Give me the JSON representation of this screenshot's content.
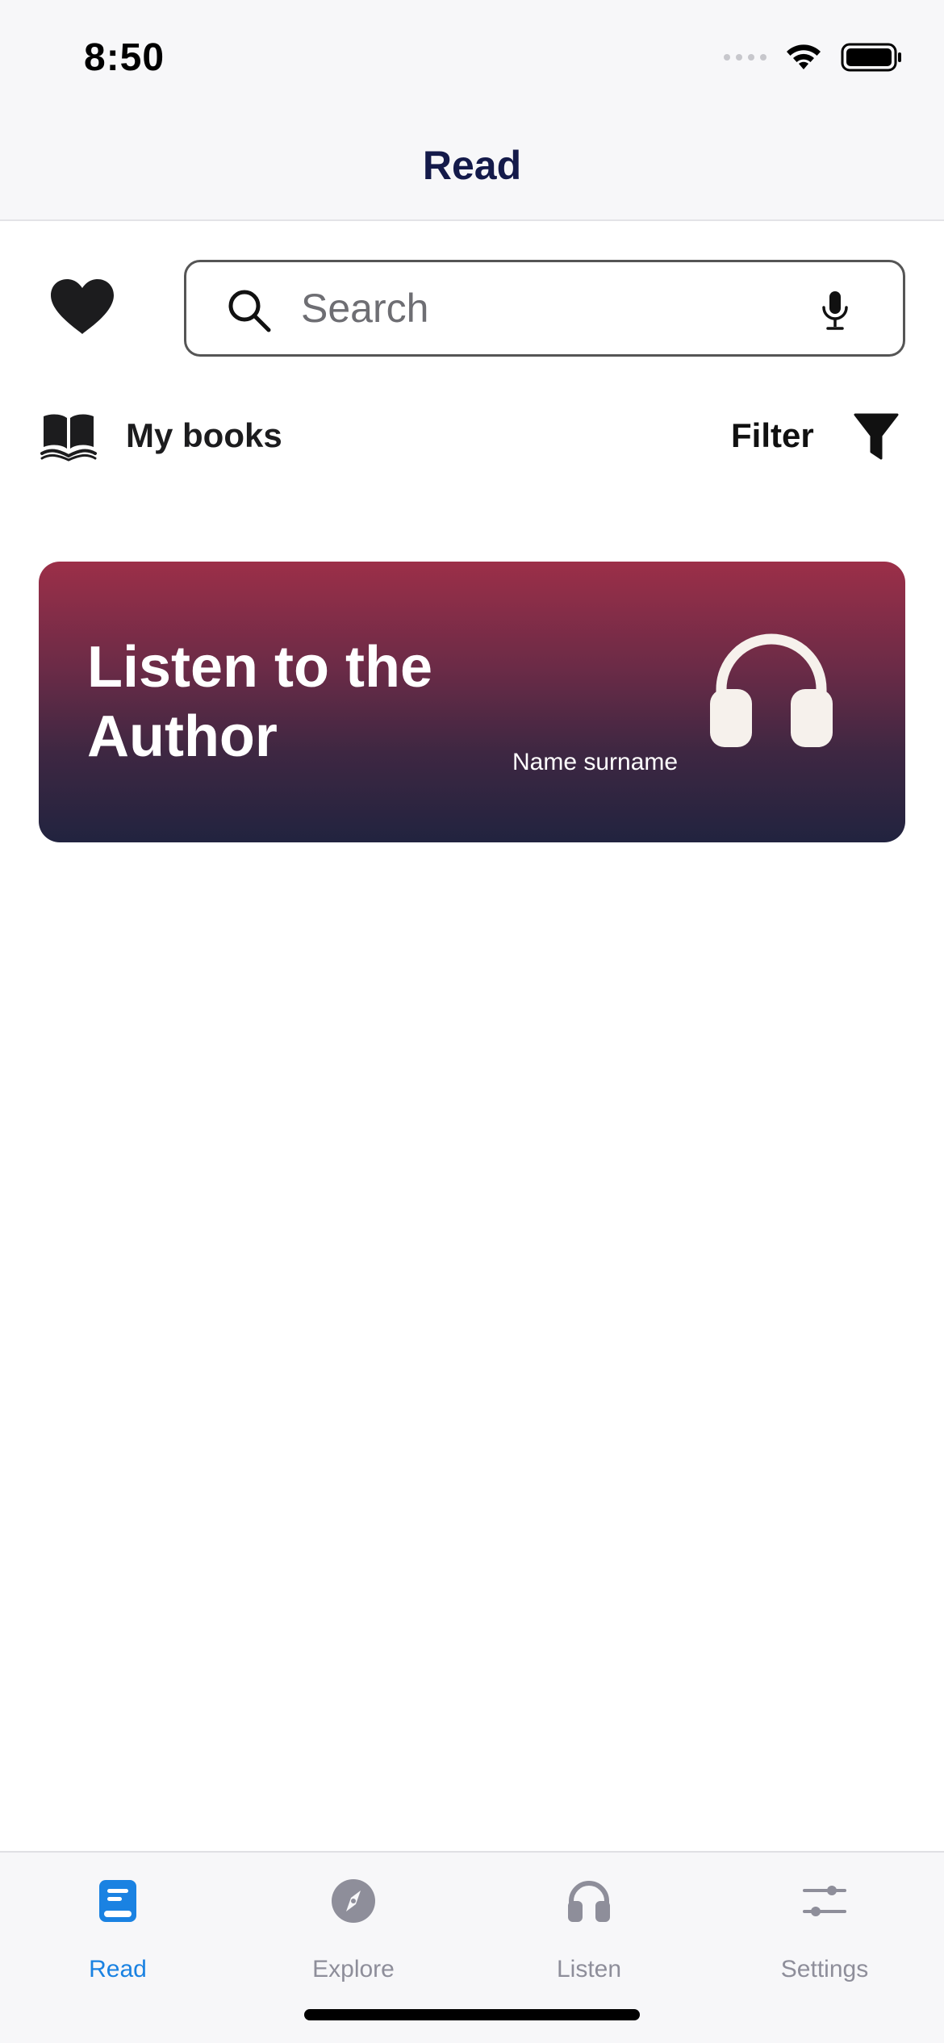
{
  "status_bar": {
    "time": "8:50",
    "icons": [
      "signal-dots-icon",
      "wifi-icon",
      "battery-icon"
    ]
  },
  "header": {
    "title": "Read"
  },
  "search": {
    "placeholder": "Search",
    "value": "",
    "left_icon": "heart-icon",
    "search_icon": "search-icon",
    "mic_icon": "microphone-icon"
  },
  "library_row": {
    "my_books_label": "My books",
    "my_books_icon": "open-book-icon",
    "filter_label": "Filter",
    "filter_icon": "funnel-icon"
  },
  "banner": {
    "title": "Listen to the Author",
    "author_name": "Name surname",
    "icon": "headphones-icon",
    "colors": {
      "top": "#9c2f48",
      "bottom": "#21233f"
    }
  },
  "tab_bar": {
    "tabs": [
      {
        "label": "Read",
        "icon": "book-icon",
        "active": true
      },
      {
        "label": "Explore",
        "icon": "compass-icon",
        "active": false
      },
      {
        "label": "Listen",
        "icon": "headphones-icon",
        "active": false
      },
      {
        "label": "Settings",
        "icon": "sliders-icon",
        "active": false
      }
    ],
    "active_color": "#1a82e2",
    "inactive_color": "#8e8e9a"
  }
}
